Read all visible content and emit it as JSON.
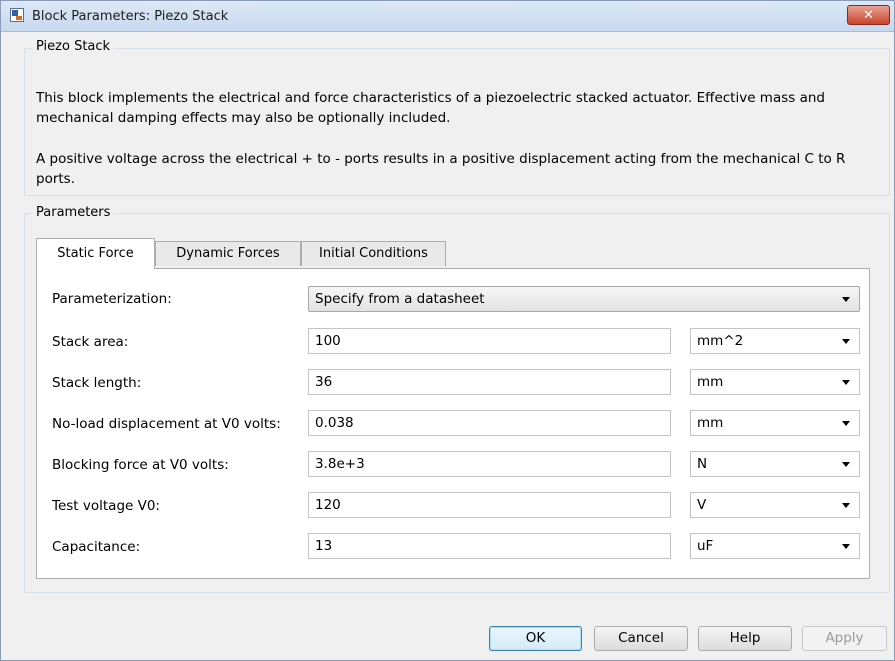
{
  "window": {
    "title": "Block Parameters: Piezo Stack",
    "close_glyph": "✕"
  },
  "block": {
    "name": "Piezo Stack",
    "description_1": "This block implements the electrical and force characteristics of a piezoelectric stacked actuator. Effective mass and mechanical damping effects may also be optionally included.",
    "description_2": "A positive voltage across the electrical + to - ports results in a positive displacement acting from the mechanical C to R ports."
  },
  "parameters": {
    "group_label": "Parameters",
    "tabs": [
      {
        "label": "Static Force"
      },
      {
        "label": "Dynamic Forces"
      },
      {
        "label": "Initial Conditions"
      }
    ],
    "parameterization": {
      "label": "Parameterization:",
      "value": "Specify from a datasheet"
    },
    "rows": [
      {
        "label": "Stack area:",
        "value": "100",
        "unit": "mm^2"
      },
      {
        "label": "Stack length:",
        "value": "36",
        "unit": "mm"
      },
      {
        "label": "No-load displacement at V0 volts:",
        "value": "0.038",
        "unit": "mm"
      },
      {
        "label": "Blocking force at V0 volts:",
        "value": "3.8e+3",
        "unit": "N"
      },
      {
        "label": "Test voltage V0:",
        "value": "120",
        "unit": "V"
      },
      {
        "label": "Capacitance:",
        "value": "13",
        "unit": "uF"
      }
    ]
  },
  "buttons": {
    "ok": "OK",
    "cancel": "Cancel",
    "help": "Help",
    "apply": "Apply"
  }
}
